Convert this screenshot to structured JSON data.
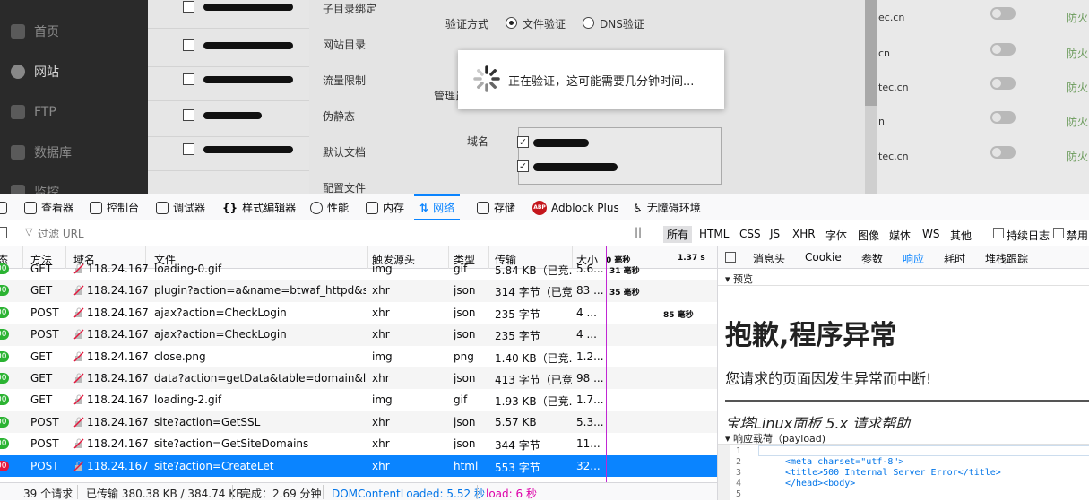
{
  "sidebar": {
    "items": [
      {
        "label": "首页",
        "icon": "home-icon"
      },
      {
        "label": "网站",
        "icon": "globe-icon"
      },
      {
        "label": "FTP",
        "icon": "ftp-icon"
      },
      {
        "label": "数据库",
        "icon": "database-icon"
      },
      {
        "label": "监控",
        "icon": "monitor-icon"
      }
    ]
  },
  "settings_nav": [
    "子目录绑定",
    "网站目录",
    "流量限制",
    "伪静态",
    "默认文档",
    "配置文件"
  ],
  "form": {
    "verify_label": "验证方式",
    "radio_file": "文件验证",
    "radio_dns": "DNS验证",
    "manage_label": "管理员",
    "domain_label": "域名"
  },
  "loading": {
    "text": "正在验证，这可能需要几分钟时间..."
  },
  "right_rows": [
    {
      "domain": "ec.cn",
      "fh": "防火"
    },
    {
      "domain": "cn",
      "fh": "防火"
    },
    {
      "domain": "tec.cn",
      "fh": "防火"
    },
    {
      "domain": "n",
      "fh": "防火"
    },
    {
      "domain": "tec.cn",
      "fh": "防火"
    }
  ],
  "devtools": {
    "tabs": [
      "查看器",
      "控制台",
      "调试器",
      "样式编辑器",
      "性能",
      "内存",
      "网络",
      "存储",
      "Adblock Plus",
      "无障碍环境"
    ],
    "active_tab": "网络",
    "filter_placeholder": "过滤 URL",
    "type_filters": [
      "所有",
      "HTML",
      "CSS",
      "JS",
      "XHR",
      "字体",
      "图像",
      "媒体",
      "WS",
      "其他"
    ],
    "persist_log": "持续日志",
    "disable_cache": "禁用"
  },
  "table": {
    "headers": [
      "态",
      "方法",
      "域名",
      "文件",
      "触发源头",
      "类型",
      "传输",
      "大小"
    ],
    "waterfall_header": "0 毫秒",
    "waterfall_header2": "1.37 s",
    "rows": [
      {
        "status": "00",
        "method": "GET",
        "domain": "118.24.167....",
        "file": "loading-0.gif",
        "cause": "img",
        "type": "gif",
        "transfer": "5.84 KB（已竞...",
        "size": "5.6...",
        "wf": "31 毫秒"
      },
      {
        "status": "00",
        "method": "GET",
        "domain": "118.24.167....",
        "file": "plugin?action=a&name=btwaf_httpd&s=g...",
        "cause": "xhr",
        "type": "json",
        "transfer": "314 字节（已竞...",
        "size": "83 ...",
        "wf": "35 毫秒"
      },
      {
        "status": "00",
        "method": "POST",
        "domain": "118.24.167....",
        "file": "ajax?action=CheckLogin",
        "cause": "xhr",
        "type": "json",
        "transfer": "235 字节",
        "size": "4 ...",
        "wf": "85 毫秒"
      },
      {
        "status": "00",
        "method": "POST",
        "domain": "118.24.167....",
        "file": "ajax?action=CheckLogin",
        "cause": "xhr",
        "type": "json",
        "transfer": "235 字节",
        "size": "4 ...",
        "wf": ""
      },
      {
        "status": "00",
        "method": "GET",
        "domain": "118.24.167....",
        "file": "close.png",
        "cause": "img",
        "type": "png",
        "transfer": "1.40 KB（已竞...",
        "size": "1.2...",
        "wf": ""
      },
      {
        "status": "00",
        "method": "GET",
        "domain": "118.24.167....",
        "file": "data?action=getData&table=domain&list=...",
        "cause": "xhr",
        "type": "json",
        "transfer": "413 字节（已竞...",
        "size": "98 ...",
        "wf": ""
      },
      {
        "status": "00",
        "method": "GET",
        "domain": "118.24.167....",
        "file": "loading-2.gif",
        "cause": "img",
        "type": "gif",
        "transfer": "1.93 KB（已竞...",
        "size": "1.7...",
        "wf": ""
      },
      {
        "status": "00",
        "method": "POST",
        "domain": "118.24.167....",
        "file": "site?action=GetSSL",
        "cause": "xhr",
        "type": "json",
        "transfer": "5.57 KB",
        "size": "5.3...",
        "wf": ""
      },
      {
        "status": "00",
        "method": "POST",
        "domain": "118.24.167....",
        "file": "site?action=GetSiteDomains",
        "cause": "xhr",
        "type": "json",
        "transfer": "344 字节",
        "size": "11...",
        "wf": ""
      },
      {
        "status": "00",
        "method": "POST",
        "domain": "118.24.167....",
        "file": "site?action=CreateLet",
        "cause": "xhr",
        "type": "html",
        "transfer": "553 字节",
        "size": "32...",
        "wf": "",
        "selected": true,
        "error": true
      }
    ]
  },
  "status_bar": {
    "requests": "39 个请求",
    "transferred": "已传输 380.38 KB / 384.74 KB",
    "finish": "完成：2.69 分钟",
    "dcl": "DOMContentLoaded: 5.52 秒",
    "load": "load: 6 秒"
  },
  "detail": {
    "tabs": [
      "消息头",
      "Cookie",
      "参数",
      "响应",
      "耗时",
      "堆栈跟踪"
    ],
    "active_tab": "响应",
    "preview_label": "预览",
    "h1": "抱歉,程序异常",
    "p": "您请求的页面因发生异常而中断!",
    "em": "宝塔Linux面板 5.x 请求帮助",
    "payload_label": "响应载荷（payload)",
    "code_lines": [
      "1",
      "2",
      "3",
      "4",
      "5"
    ],
    "code_meta": "<meta charset=\"utf-8\">",
    "code_title": "<title>500 Internal Server Error</title>",
    "code_head": "</head><body>"
  },
  "colors": {
    "accent": "#0a84ff",
    "ok": "#2bb332",
    "error": "#e4173d",
    "waterfall": "#c026d3"
  }
}
